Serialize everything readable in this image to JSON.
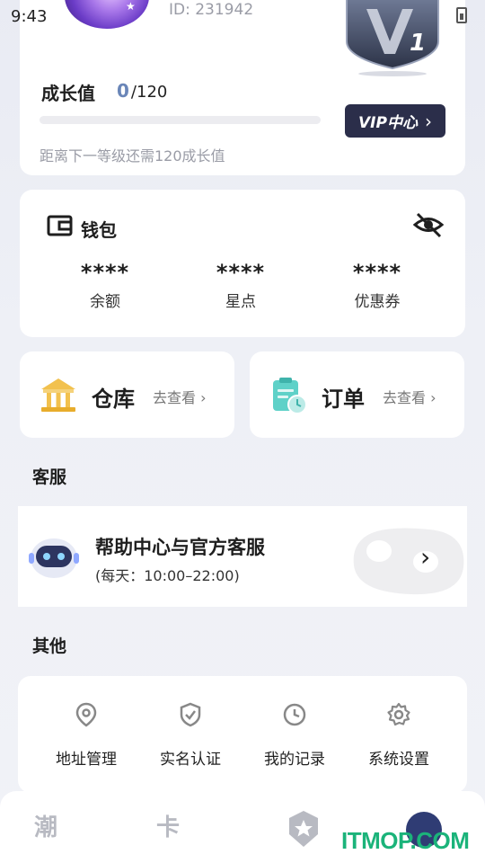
{
  "status_bar": {
    "time": "9:43"
  },
  "profile": {
    "user_id": "ID: 231942",
    "vip_level": "1"
  },
  "growth": {
    "label": "成长值",
    "current": "0",
    "total": "/120",
    "progress": 0,
    "hint": "距离下一等级还需120成长值",
    "vip_button": "VIP中心"
  },
  "wallet": {
    "title": "钱包",
    "items": [
      {
        "value": "****",
        "label": "余额"
      },
      {
        "value": "****",
        "label": "星点"
      },
      {
        "value": "****",
        "label": "优惠券"
      }
    ]
  },
  "quick": {
    "warehouse": {
      "title": "仓库",
      "link": "去查看 ›"
    },
    "orders": {
      "title": "订单",
      "link": "去查看 ›"
    }
  },
  "service": {
    "section_title": "客服",
    "help_title": "帮助中心与官方客服",
    "help_hours": "(每天：10:00–22:00)"
  },
  "other": {
    "section_title": "其他",
    "items": [
      {
        "label": "地址管理",
        "icon": "location-icon"
      },
      {
        "label": "实名认证",
        "icon": "shield-check-icon"
      },
      {
        "label": "我的记录",
        "icon": "clock-icon"
      },
      {
        "label": "系统设置",
        "icon": "gear-icon"
      }
    ]
  },
  "bottom_nav": {
    "items": [
      {
        "glyph": "潮",
        "icon": "trend-icon"
      },
      {
        "glyph": "卡",
        "icon": "card-icon"
      },
      {
        "glyph": "",
        "icon": "badge-star-icon"
      },
      {
        "glyph": "",
        "icon": "profile-icon"
      }
    ]
  },
  "watermark": "ITMOP.COM",
  "colors": {
    "accent": "#6a86b8",
    "vip_button_bg": "#2b2e4a",
    "watermark": "#1bb37a"
  }
}
